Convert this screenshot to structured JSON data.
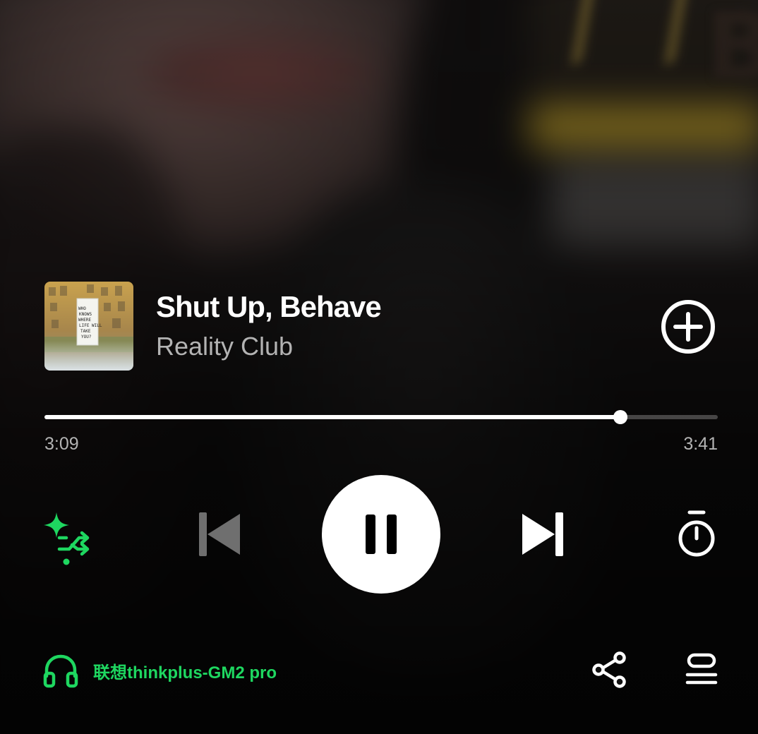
{
  "track": {
    "title": "Shut Up, Behave",
    "artist": "Reality Club",
    "album_art_text": "WHO KNOWS WHERE LIFE WILL TAKE YOU?"
  },
  "playback": {
    "elapsed": "3:09",
    "duration": "3:41",
    "progress_fraction": 0.855,
    "state": "playing"
  },
  "controls": {
    "smart_shuffle_icon": "smart-shuffle-icon",
    "previous_icon": "skip-previous-icon",
    "pause_icon": "pause-icon",
    "next_icon": "skip-next-icon",
    "timer_icon": "sleep-timer-icon",
    "add_icon": "plus-circle-icon"
  },
  "device": {
    "name": "联想thinkplus-GM2 pro",
    "icon": "headphones-icon"
  },
  "actions": {
    "share_icon": "share-icon",
    "queue_icon": "queue-icon"
  },
  "colors": {
    "accent": "#1ed760",
    "text_primary": "#ffffff",
    "text_secondary": "#b3b3b3"
  }
}
